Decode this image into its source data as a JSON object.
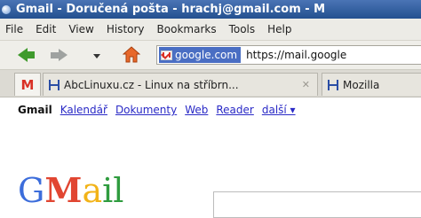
{
  "window": {
    "title": "Gmail - Doručená pošta - hrachj@gmail.com - M"
  },
  "menu": {
    "items": [
      {
        "label": "File",
        "accel": "F"
      },
      {
        "label": "Edit",
        "accel": "E"
      },
      {
        "label": "View",
        "accel": "V"
      },
      {
        "label": "History",
        "accel": "s"
      },
      {
        "label": "Bookmarks",
        "accel": "B"
      },
      {
        "label": "Tools",
        "accel": "T"
      },
      {
        "label": "Help",
        "accel": "H"
      }
    ]
  },
  "navigation": {
    "site_badge": "google.com",
    "url": "https://mail.google"
  },
  "tabs": [
    {
      "label": "",
      "icon": "gmail-icon"
    },
    {
      "label": "AbcLinuxu.cz - Linux na stříbrn...",
      "icon": "mozilla-icon",
      "close": "✕"
    },
    {
      "label": "Mozilla",
      "icon": "mozilla-icon"
    }
  ],
  "gmail_links": {
    "current": "Gmail",
    "links": [
      "Kalendář",
      "Dokumenty",
      "Web",
      "Reader"
    ],
    "more": "další ▾"
  },
  "logo": {
    "text": "Gmail"
  }
}
